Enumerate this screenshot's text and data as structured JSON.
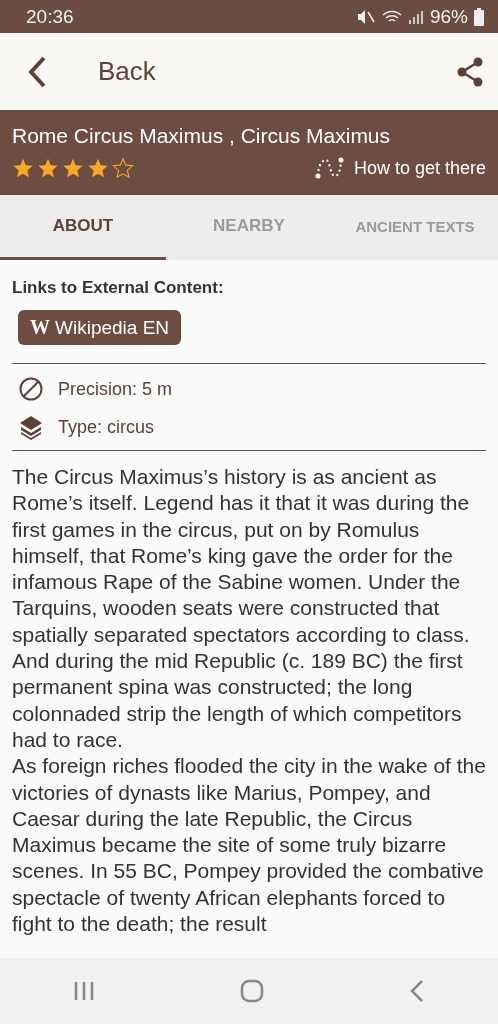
{
  "status_bar": {
    "time": "20:36",
    "battery": "96%"
  },
  "app_bar": {
    "back_label": "Back"
  },
  "header": {
    "title": "Rome Circus Maximus , Circus Maximus",
    "stars": 4,
    "directions": "How to get there"
  },
  "tabs": [
    {
      "label": "ABOUT",
      "selected": true
    },
    {
      "label": "NEARBY",
      "selected": false
    },
    {
      "label": "ANCIENT TEXTS",
      "selected": false
    }
  ],
  "links": {
    "heading": "Links to External Content:",
    "buttons": [
      {
        "icon_letter": "W",
        "label": "Wikipedia EN"
      }
    ]
  },
  "info": [
    {
      "kind": "precision",
      "text": "Precision: 5 m"
    },
    {
      "kind": "type",
      "text": "Type: circus"
    }
  ],
  "description": [
    "The Circus Maximus’s history is as ancient as Rome’s itself. Legend has it that it was during the first games in the circus, put on by Romulus himself, that Rome’s king gave the order for the infamous Rape of the Sabine women. Under the Tarquins, wooden seats were constructed that spatially separated spectators according to class. And during the mid Republic (c. 189 BC) the first permanent spina was constructed; the long colonnaded strip the length of which competitors had to race.",
    "As foreign riches flooded the city in the wake of the victories of dynasts like Marius, Pompey, and Caesar during the late Republic, the Circus Maximus became the site of some truly bizarre scenes. In 55 BC, Pompey provided the combative spectacle of twenty African elephants forced to fight to the death; the result"
  ]
}
